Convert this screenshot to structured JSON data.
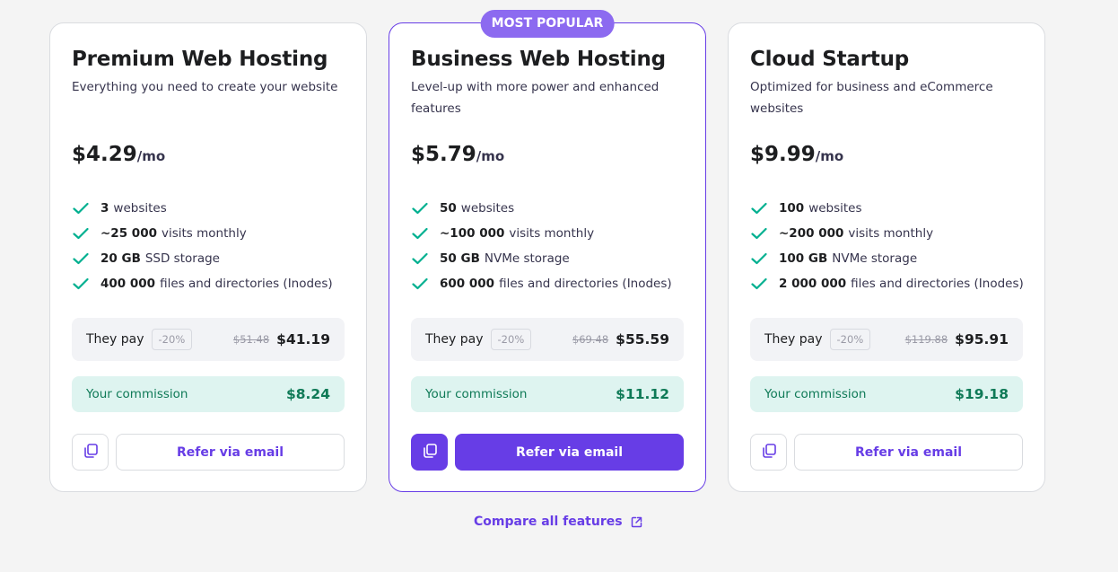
{
  "colors": {
    "accent": "#673de6",
    "badge": "#8c6af0",
    "check": "#00b090",
    "commission": "#0f7a57"
  },
  "plans": [
    {
      "title": "Premium Web Hosting",
      "subtitle": "Everything you need to create your website",
      "price": "$4.29",
      "period": "/mo",
      "features": [
        {
          "bold": "3",
          "text": "websites"
        },
        {
          "bold": "~25 000",
          "text": "visits monthly"
        },
        {
          "bold": "20 GB",
          "text": "SSD storage"
        },
        {
          "bold": "400 000",
          "text": "files and directories (Inodes)"
        }
      ],
      "pay_label": "They pay",
      "discount": "-20%",
      "old_price": "$51.48",
      "new_price": "$41.19",
      "commission_label": "Your commission",
      "commission": "$8.24",
      "refer_label": "Refer via email"
    },
    {
      "badge": "MOST POPULAR",
      "title": "Business Web Hosting",
      "subtitle": "Level-up with more power and enhanced features",
      "price": "$5.79",
      "period": "/mo",
      "features": [
        {
          "bold": "50",
          "text": "websites"
        },
        {
          "bold": "~100 000",
          "text": "visits monthly"
        },
        {
          "bold": "50 GB",
          "text": "NVMe storage"
        },
        {
          "bold": "600 000",
          "text": "files and directories (Inodes)"
        }
      ],
      "pay_label": "They pay",
      "discount": "-20%",
      "old_price": "$69.48",
      "new_price": "$55.59",
      "commission_label": "Your commission",
      "commission": "$11.12",
      "refer_label": "Refer via email"
    },
    {
      "title": "Cloud Startup",
      "subtitle": "Optimized for business and eCommerce websites",
      "price": "$9.99",
      "period": "/mo",
      "features": [
        {
          "bold": "100",
          "text": "websites"
        },
        {
          "bold": "~200 000",
          "text": "visits monthly"
        },
        {
          "bold": "100 GB",
          "text": "NVMe storage"
        },
        {
          "bold": "2 000 000",
          "text": "files and directories (Inodes)"
        }
      ],
      "pay_label": "They pay",
      "discount": "-20%",
      "old_price": "$119.88",
      "new_price": "$95.91",
      "commission_label": "Your commission",
      "commission": "$19.18",
      "refer_label": "Refer via email"
    }
  ],
  "compare_link": "Compare all features",
  "icons": {
    "feature": "check-icon",
    "copy": "copy-icon",
    "link": "external-link-icon"
  }
}
